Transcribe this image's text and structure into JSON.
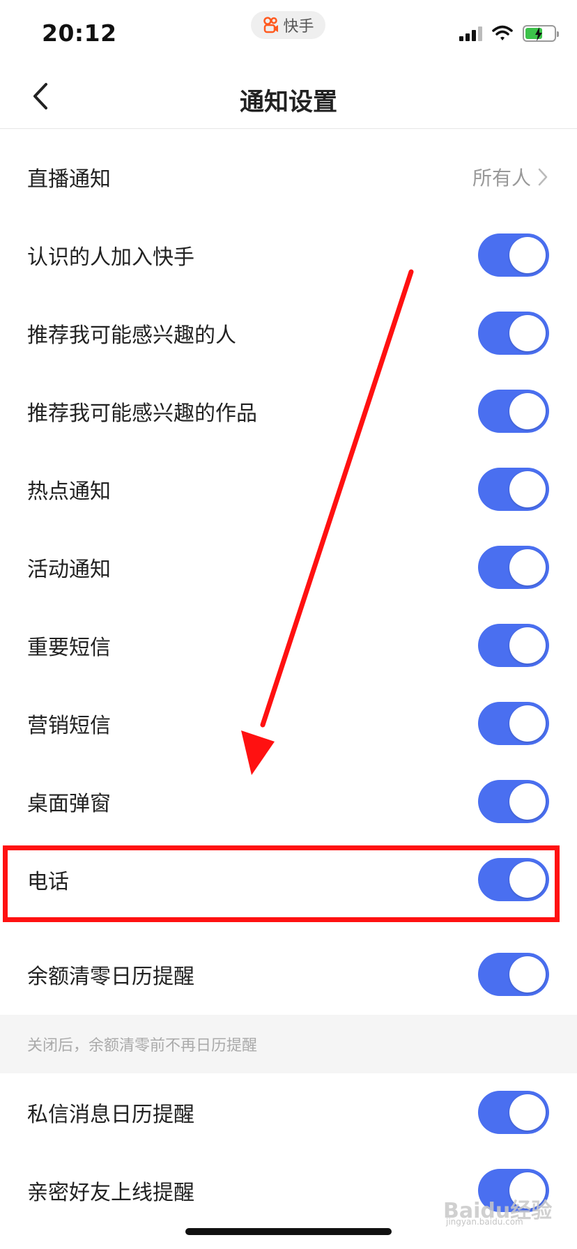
{
  "status_bar": {
    "time": "20:12",
    "app_pill": "快手"
  },
  "nav": {
    "title": "通知设置"
  },
  "live_row": {
    "label": "直播通知",
    "value": "所有人"
  },
  "rows": [
    {
      "label": "认识的人加入快手",
      "on": true
    },
    {
      "label": "推荐我可能感兴趣的人",
      "on": true
    },
    {
      "label": "推荐我可能感兴趣的作品",
      "on": true
    },
    {
      "label": "热点通知",
      "on": true
    },
    {
      "label": "活动通知",
      "on": true
    },
    {
      "label": "重要短信",
      "on": true
    },
    {
      "label": "营销短信",
      "on": true
    },
    {
      "label": "桌面弹窗",
      "on": true
    },
    {
      "label": "电话",
      "on": true
    },
    {
      "label": "余额清零日历提醒",
      "on": true
    },
    {
      "label": "私信消息日历提醒",
      "on": true
    },
    {
      "label": "亲密好友上线提醒",
      "on": true
    }
  ],
  "note": "关闭后，余额清零前不再日历提醒",
  "watermark": {
    "main": "Baidu经验",
    "sub": "jingyan.baidu.com"
  },
  "colors": {
    "toggle_on": "#4a6ff0",
    "annotation": "#ff1111"
  }
}
